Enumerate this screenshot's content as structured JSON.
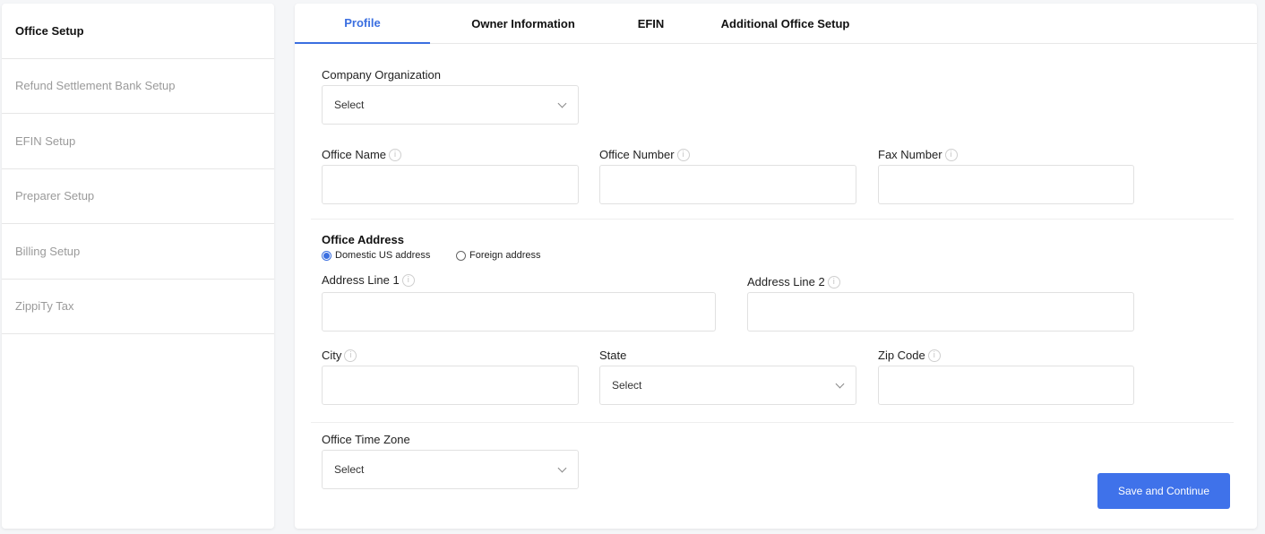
{
  "sidebar": {
    "items": [
      {
        "label": "Office Setup",
        "active": true
      },
      {
        "label": "Refund Settlement Bank Setup",
        "active": false
      },
      {
        "label": "EFIN Setup",
        "active": false
      },
      {
        "label": "Preparer Setup",
        "active": false
      },
      {
        "label": "Billing Setup",
        "active": false
      },
      {
        "label": "ZippiTy Tax",
        "active": false
      }
    ]
  },
  "tabs": [
    {
      "label": "Profile",
      "active": true
    },
    {
      "label": "Owner Information",
      "active": false
    },
    {
      "label": "EFIN",
      "active": false
    },
    {
      "label": "Additional Office Setup",
      "active": false
    }
  ],
  "form": {
    "company_org": {
      "label": "Company Organization",
      "value": "Select"
    },
    "office_name": {
      "label": "Office Name",
      "value": ""
    },
    "office_number": {
      "label": "Office Number",
      "value": ""
    },
    "fax_number": {
      "label": "Fax Number",
      "value": ""
    },
    "address_section": {
      "title": "Office Address",
      "radio_domestic": "Domestic US address",
      "radio_foreign": "Foreign address",
      "selected": "domestic"
    },
    "address_line1": {
      "label": "Address Line 1",
      "value": ""
    },
    "address_line2": {
      "label": "Address Line 2",
      "value": ""
    },
    "city": {
      "label": "City",
      "value": ""
    },
    "state": {
      "label": "State",
      "value": "Select"
    },
    "zip": {
      "label": "Zip Code",
      "value": ""
    },
    "timezone": {
      "label": "Office Time Zone",
      "value": "Select"
    }
  },
  "actions": {
    "save_label": "Save and Continue"
  },
  "icons": {
    "info": "i"
  },
  "colors": {
    "accent": "#3b6fe0",
    "button": "#3f72ea"
  }
}
